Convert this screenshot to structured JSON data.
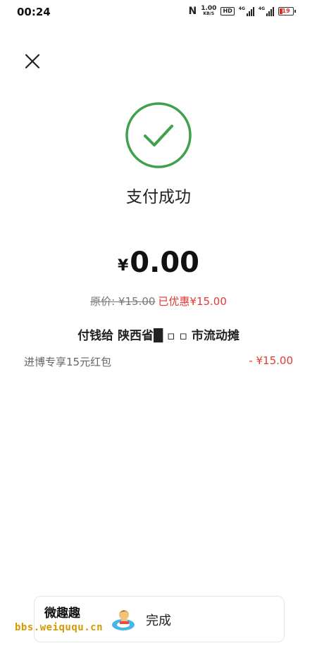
{
  "status_bar": {
    "time": "00:24",
    "nfc": "N",
    "net_speed": "1.00",
    "net_unit": "KB/S",
    "hd": "HD",
    "signal1_tag": "4G",
    "signal2_tag": "4G",
    "battery": "19",
    "icons": [
      "nfc-icon",
      "hd-icon",
      "signal-icon",
      "signal-icon",
      "battery-icon"
    ]
  },
  "header": {
    "close_icon": "close-icon"
  },
  "result": {
    "icon": "check-circle-icon",
    "accent_color": "#3fa14a",
    "title": "支付成功",
    "currency": "¥",
    "amount": "0.00",
    "original_price": "原价: ¥15.00",
    "discount_text": "已优惠¥15.00",
    "discount_color": "#e53935",
    "payee": "付钱给 陕西省█  ▫  ▫  市流动摊"
  },
  "coupon": {
    "name": "进博专享15元红包",
    "value": "- ¥15.00"
  },
  "done": {
    "label": "完成"
  },
  "watermark": {
    "line1": "微趣趣",
    "line2": "bbs.weiququ.cn"
  }
}
